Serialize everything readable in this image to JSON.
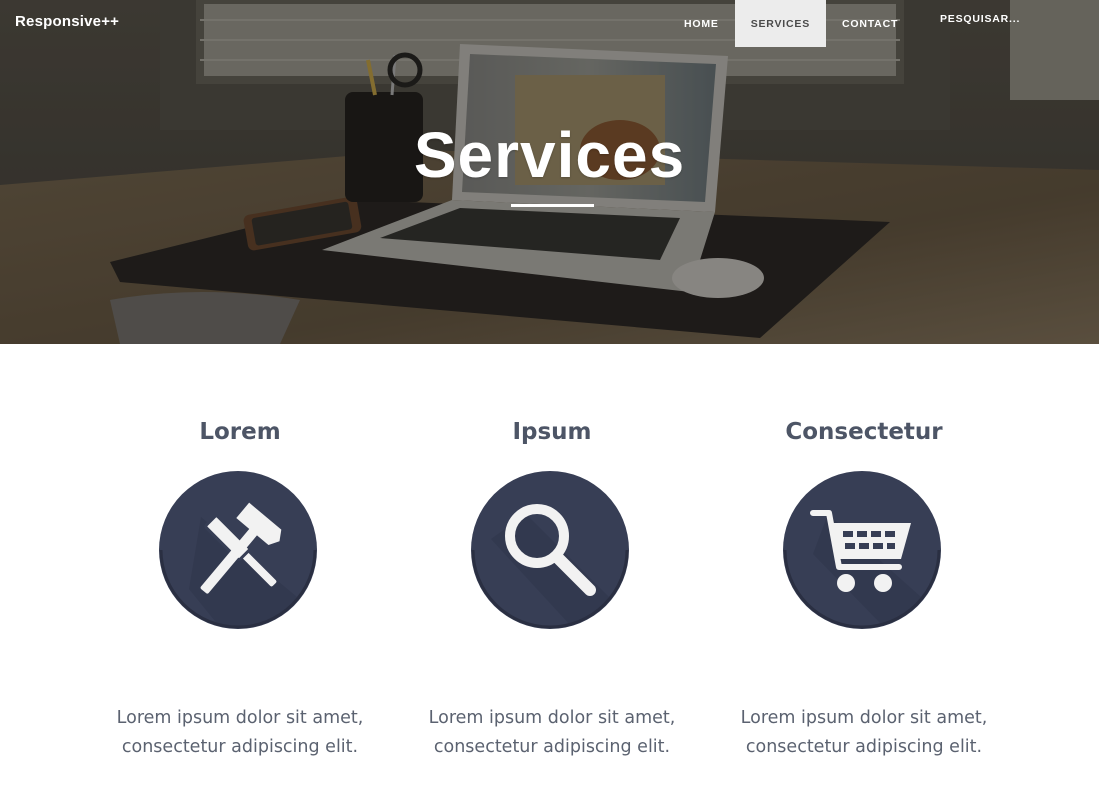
{
  "navbar": {
    "brand": "Responsive++",
    "items": [
      {
        "label": "Home",
        "active": false
      },
      {
        "label": "Services",
        "active": true
      },
      {
        "label": "Contact",
        "active": false
      }
    ],
    "search_placeholder": "PESQUISAR..."
  },
  "hero": {
    "title": "Services",
    "background_photo": "desk-with-laptop-photo"
  },
  "services": [
    {
      "title": "Lorem",
      "icon": "tools-icon",
      "text_line1": "Lorem ipsum dolor sit amet,",
      "text_line2": "consectetur adipiscing elit."
    },
    {
      "title": "Ipsum",
      "icon": "search-icon",
      "text_line1": "Lorem ipsum dolor sit amet,",
      "text_line2": "consectetur adipiscing elit."
    },
    {
      "title": "Consectetur",
      "icon": "cart-icon",
      "text_line1": "Lorem ipsum dolor sit amet,",
      "text_line2": "consectetur adipiscing elit."
    }
  ],
  "colors": {
    "icon_circle": "#373e55",
    "icon_shadow": "#2c3144",
    "icon_glyph": "#f2f2f2",
    "active_nav_bg": "#ececec",
    "heading_text": "#4d5566",
    "body_text": "#5b6270"
  }
}
